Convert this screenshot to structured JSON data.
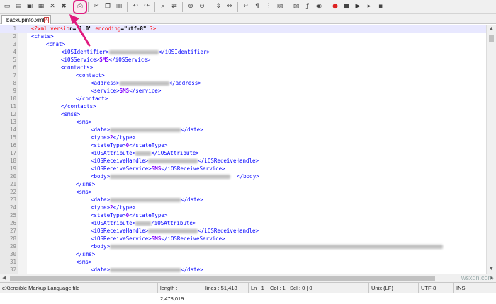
{
  "toolbar": {
    "icons": [
      "new-file-icon",
      "open-file-icon",
      "save-icon",
      "save-all-icon",
      "close-icon",
      "close-all-icon",
      "print-icon",
      "cut-icon",
      "copy-icon",
      "paste-icon",
      "undo-icon",
      "redo-icon",
      "find-icon",
      "replace-icon",
      "zoom-in-icon",
      "zoom-out-icon",
      "sync-vertical-icon",
      "sync-horizontal-icon",
      "word-wrap-icon",
      "show-all-characters-icon",
      "indent-guide-icon",
      "user-defined-language-icon",
      "document-map-icon",
      "function-list-icon",
      "monitoring-icon",
      "record-macro-icon",
      "stop-macro-icon",
      "play-macro-icon",
      "run-macro-multiple-icon",
      "save-macro-icon"
    ],
    "highlighted": "print-icon",
    "accent_color": "#e0197e"
  },
  "tab": {
    "label": "backupinfo.xml"
  },
  "lines": [
    {
      "n": "1",
      "parts": [
        [
          "decl",
          "<?xml versio"
        ],
        [
          "text",
          "n=\"1.0\" "
        ],
        [
          "attr",
          "encoding"
        ],
        [
          "text",
          "=\"utf-8\" "
        ],
        [
          "decl",
          "?>"
        ]
      ]
    },
    {
      "n": "2",
      "indent": 0,
      "parts": [
        [
          "tag",
          "<chats>"
        ]
      ]
    },
    {
      "n": "3",
      "indent": 1,
      "parts": [
        [
          "tag",
          "<chat>"
        ]
      ]
    },
    {
      "n": "4",
      "indent": 2,
      "parts": [
        [
          "tag",
          "<iOSIdentifier>"
        ],
        [
          "blur",
          "70"
        ],
        [
          "tag",
          "</iOSIdentifier>"
        ]
      ]
    },
    {
      "n": "5",
      "indent": 2,
      "parts": [
        [
          "tag",
          "<iOSService>"
        ],
        [
          "val",
          "SMS"
        ],
        [
          "tag",
          "</iOSService>"
        ]
      ]
    },
    {
      "n": "6",
      "indent": 2,
      "parts": [
        [
          "tag",
          "<contacts>"
        ]
      ]
    },
    {
      "n": "7",
      "indent": 3,
      "parts": [
        [
          "tag",
          "<contact>"
        ]
      ]
    },
    {
      "n": "8",
      "indent": 4,
      "parts": [
        [
          "tag",
          "<address>"
        ],
        [
          "blur",
          "70"
        ],
        [
          "tag",
          "</address>"
        ]
      ]
    },
    {
      "n": "9",
      "indent": 4,
      "parts": [
        [
          "tag",
          "<service>"
        ],
        [
          "val",
          "SMS"
        ],
        [
          "tag",
          "</service>"
        ]
      ]
    },
    {
      "n": "10",
      "indent": 3,
      "parts": [
        [
          "tag",
          "</contact>"
        ]
      ]
    },
    {
      "n": "11",
      "indent": 2,
      "parts": [
        [
          "tag",
          "</contacts>"
        ]
      ]
    },
    {
      "n": "12",
      "indent": 2,
      "parts": [
        [
          "tag",
          "<smss>"
        ]
      ]
    },
    {
      "n": "13",
      "indent": 3,
      "parts": [
        [
          "tag",
          "<sms>"
        ]
      ]
    },
    {
      "n": "14",
      "indent": 4,
      "parts": [
        [
          "tag",
          "<date>"
        ],
        [
          "blur",
          "100"
        ],
        [
          "tag",
          "</date>"
        ]
      ]
    },
    {
      "n": "15",
      "indent": 4,
      "parts": [
        [
          "tag",
          "<type>"
        ],
        [
          "val",
          "2"
        ],
        [
          "tag",
          "</type>"
        ]
      ]
    },
    {
      "n": "16",
      "indent": 4,
      "parts": [
        [
          "tag",
          "<stateType>"
        ],
        [
          "val",
          "0"
        ],
        [
          "tag",
          "</stateType>"
        ]
      ]
    },
    {
      "n": "17",
      "indent": 4,
      "parts": [
        [
          "tag",
          "<iOSAttribute>"
        ],
        [
          "blur",
          "22"
        ],
        [
          "tag",
          "</iOSAttribute>"
        ]
      ]
    },
    {
      "n": "18",
      "indent": 4,
      "parts": [
        [
          "tag",
          "<iOSReceiveHandle>"
        ],
        [
          "blur",
          "70"
        ],
        [
          "tag",
          "</iOSReceiveHandle>"
        ]
      ]
    },
    {
      "n": "19",
      "indent": 4,
      "parts": [
        [
          "tag",
          "<iOSReceiveService>"
        ],
        [
          "val",
          "SMS"
        ],
        [
          "tag",
          "</iOSReceiveService>"
        ]
      ]
    },
    {
      "n": "20",
      "indent": 4,
      "parts": [
        [
          "tag",
          "<body>"
        ],
        [
          "blur",
          "170"
        ],
        [
          "tag",
          "  </body>"
        ]
      ]
    },
    {
      "n": "21",
      "indent": 3,
      "parts": [
        [
          "tag",
          "</sms>"
        ]
      ]
    },
    {
      "n": "22",
      "indent": 3,
      "parts": [
        [
          "tag",
          "<sms>"
        ]
      ]
    },
    {
      "n": "23",
      "indent": 4,
      "parts": [
        [
          "tag",
          "<date>"
        ],
        [
          "blur",
          "100"
        ],
        [
          "tag",
          "</date>"
        ]
      ]
    },
    {
      "n": "24",
      "indent": 4,
      "parts": [
        [
          "tag",
          "<type>"
        ],
        [
          "val",
          "2"
        ],
        [
          "tag",
          "</type>"
        ]
      ]
    },
    {
      "n": "25",
      "indent": 4,
      "parts": [
        [
          "tag",
          "<stateType>"
        ],
        [
          "val",
          "0"
        ],
        [
          "tag",
          "</stateType>"
        ]
      ]
    },
    {
      "n": "26",
      "indent": 4,
      "parts": [
        [
          "tag",
          "<iOSAttribute>"
        ],
        [
          "blur",
          "22"
        ],
        [
          "tag",
          "/iOSAttribute>"
        ]
      ]
    },
    {
      "n": "27",
      "indent": 4,
      "parts": [
        [
          "tag",
          "<iOSReceiveHandle>"
        ],
        [
          "blur",
          "70"
        ],
        [
          "tag",
          "</iOSReceiveHandle>"
        ]
      ]
    },
    {
      "n": "28",
      "indent": 4,
      "parts": [
        [
          "tag",
          "<iOSReceiveService>"
        ],
        [
          "val",
          "SMS"
        ],
        [
          "tag",
          "</iOSReceiveService>"
        ]
      ]
    },
    {
      "n": "29",
      "indent": 4,
      "parts": [
        [
          "tag",
          "<body>"
        ],
        [
          "blur",
          "470"
        ]
      ]
    },
    {
      "n": "30",
      "indent": 3,
      "parts": [
        [
          "tag",
          "</sms>"
        ]
      ]
    },
    {
      "n": "31",
      "indent": 3,
      "parts": [
        [
          "tag",
          "<sms>"
        ]
      ]
    },
    {
      "n": "32",
      "indent": 4,
      "parts": [
        [
          "tag",
          "<date>"
        ],
        [
          "blur",
          "100"
        ],
        [
          "tag",
          "</date>"
        ]
      ]
    }
  ],
  "status": {
    "file_type": "eXtensible Markup Language file",
    "length": "length : 2,478,019",
    "lines": "lines : 51,418",
    "ln": "Ln : 1",
    "col": "Col : 1",
    "sel": "Sel : 0 | 0",
    "eol": "Unix (LF)",
    "encoding": "UTF-8",
    "mode": "INS"
  },
  "watermark": "wsxdn.com"
}
